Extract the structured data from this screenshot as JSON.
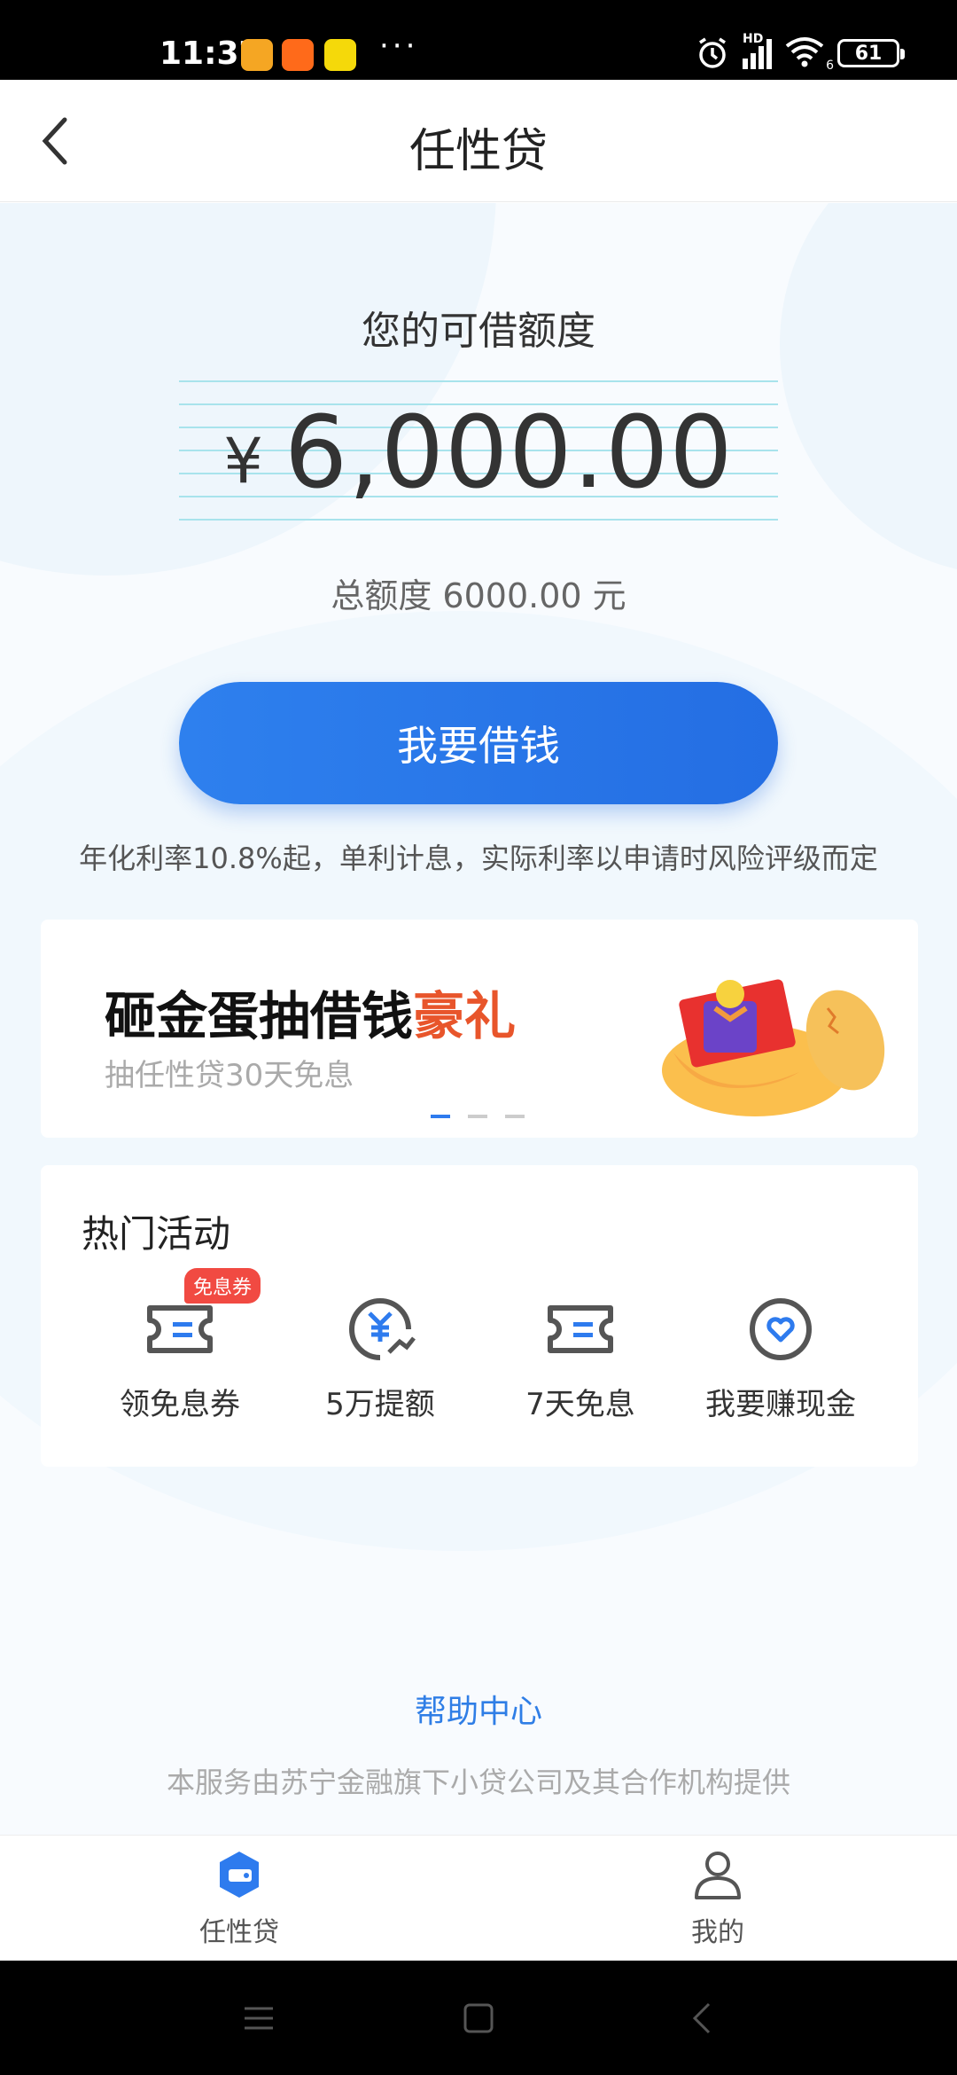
{
  "status_bar": {
    "time": "11:37",
    "dots": "···",
    "network": "HD",
    "wifi_sub": "6",
    "battery": "61"
  },
  "header": {
    "title": "任性贷",
    "back_icon": "chevron-left-icon"
  },
  "quota": {
    "title": "您的可借额度",
    "currency": "¥",
    "amount": "6,000.00",
    "total": "总额度 6000.00 元"
  },
  "borrow_button": {
    "label": "我要借钱"
  },
  "rate_note": "年化利率10.8%起，单利计息，实际利率以申请时风险评级而定",
  "banner": {
    "title_main": "砸金蛋抽借钱",
    "title_highlight": "豪礼",
    "subtitle": "抽任性贷30天免息",
    "slide_index": 0,
    "slide_count": 3
  },
  "activities": {
    "title": "热门活动",
    "items": [
      {
        "label": "领免息券",
        "icon": "ticket-icon",
        "badge": "免息券"
      },
      {
        "label": "5万提额",
        "icon": "yuan-growth-icon"
      },
      {
        "label": "7天免息",
        "icon": "ticket-icon"
      },
      {
        "label": "我要赚现金",
        "icon": "heart-circle-icon"
      }
    ]
  },
  "help_center": "帮助中心",
  "service_note": "本服务由苏宁金融旗下小贷公司及其合作机构提供",
  "tabs": [
    {
      "label": "任性贷",
      "icon": "wallet-icon",
      "active": true
    },
    {
      "label": "我的",
      "icon": "user-icon",
      "active": false
    }
  ],
  "colors": {
    "accent": "#2E7BEE",
    "highlight": "#E8552B",
    "badge": "#F14A42"
  }
}
